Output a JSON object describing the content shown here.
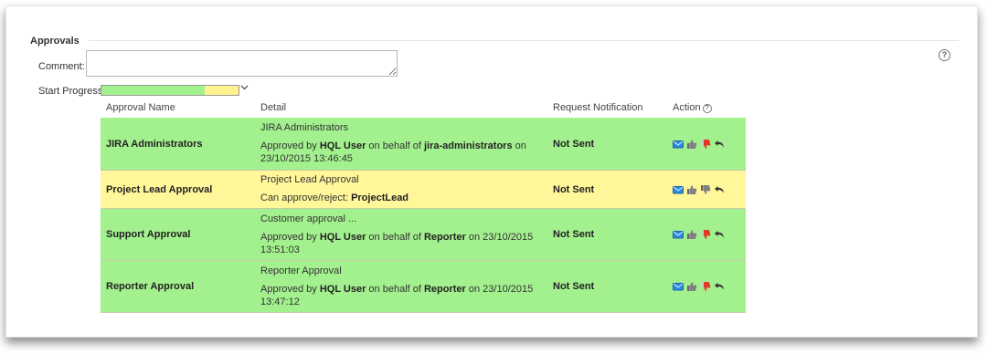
{
  "section": {
    "title": "Approvals",
    "help": "?"
  },
  "comment": {
    "label": "Comment:",
    "value": ""
  },
  "progress": {
    "label": "Start Progress",
    "segments": [
      {
        "color": "#a3f08e",
        "fraction": 0.75
      },
      {
        "color": "#fff28e",
        "fraction": 0.25
      }
    ]
  },
  "colors": {
    "approved": "#a3f08e",
    "pending": "#fff799"
  },
  "table": {
    "headers": [
      "Approval Name",
      "Detail",
      "Request Notification",
      "Action"
    ],
    "action_help": "?",
    "rows": [
      {
        "status": "approved",
        "name": "JIRA Administrators",
        "detail_title": "JIRA Administrators",
        "info": [
          {
            "t": "Approved by ",
            "b": false
          },
          {
            "t": "HQL User",
            "b": true
          },
          {
            "t": " on behalf of ",
            "b": false
          },
          {
            "t": "jira-administrators",
            "b": true
          },
          {
            "t": " on 23/10/2015 13:46:45",
            "b": false
          }
        ],
        "notification": "Not Sent",
        "actions": [
          "mail-icon",
          "thumbs-up-icon",
          "thumbs-down-icon",
          "undo-icon"
        ]
      },
      {
        "status": "pending",
        "name": "Project Lead Approval",
        "detail_title": "Project Lead Approval",
        "info": [
          {
            "t": "Can approve/reject: ",
            "b": false
          },
          {
            "t": "ProjectLead",
            "b": true
          }
        ],
        "notification": "Not Sent",
        "actions": [
          "mail-icon",
          "thumbs-up-icon",
          "thumbs-down-icon",
          "undo-icon"
        ]
      },
      {
        "status": "approved",
        "name": "Support Approval",
        "detail_title": "Customer approval ...",
        "info": [
          {
            "t": "Approved by ",
            "b": false
          },
          {
            "t": "HQL User",
            "b": true
          },
          {
            "t": " on behalf of ",
            "b": false
          },
          {
            "t": "Reporter",
            "b": true
          },
          {
            "t": " on 23/10/2015 13:51:03",
            "b": false
          }
        ],
        "notification": "Not Sent",
        "actions": [
          "mail-icon",
          "thumbs-up-icon",
          "thumbs-down-icon",
          "undo-icon"
        ]
      },
      {
        "status": "approved",
        "name": "Reporter Approval",
        "detail_title": "Reporter Approval",
        "info": [
          {
            "t": "Approved by ",
            "b": false
          },
          {
            "t": "HQL User",
            "b": true
          },
          {
            "t": " on behalf of ",
            "b": false
          },
          {
            "t": "Reporter",
            "b": true
          },
          {
            "t": " on 23/10/2015 13:47:12",
            "b": false
          }
        ],
        "notification": "Not Sent",
        "actions": [
          "mail-icon",
          "thumbs-up-icon",
          "thumbs-down-icon",
          "undo-icon"
        ]
      }
    ]
  }
}
